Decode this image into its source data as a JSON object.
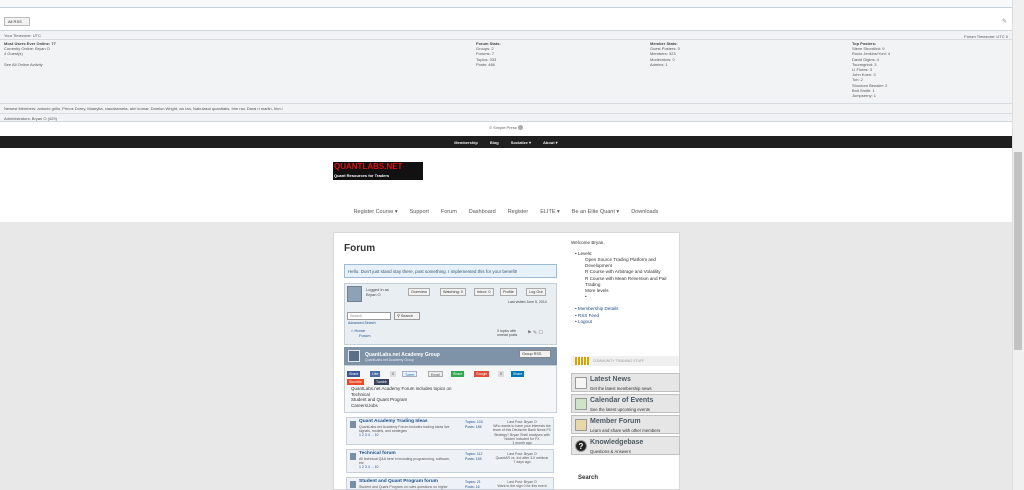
{
  "rss_label": "All RSS",
  "stats": {
    "your_timezone": "Your Timezone: UTC",
    "forum_timezone": "Forum Timezone: UTC 0",
    "most_users": "Most Users Ever Online: 77",
    "currently_online": "Currently Online: Bryan O",
    "guests": "4 Guest(s)",
    "see_all": "See All Online Activity",
    "forum_stats": [
      "Forum Stats:",
      "Groups: 2",
      "Forums: 7",
      "Topics: 333",
      "Posts: 466"
    ],
    "member_stats": [
      "Member Stats:",
      "Guest Posters: 0",
      "Members: 323",
      "Moderators: 0",
      "Admins: 1"
    ],
    "top_posters": [
      "Top Posters:",
      "Steve Sbordlich: 9",
      "Rocio Jenkins/Yoni: 4",
      "David Digins: 4",
      "Tourmgrind: 3",
      "LI Flores: 3",
      "John Koen: 3",
      "Toh: 2",
      "Shoutom Benaler: 2",
      "Bnit Smith: 1",
      "Jumpserny: 1"
    ],
    "newest_members": "Newest Members: antonio grillo, Prinos Dorey, Maaryita, claudasmeta, ahri kumar, Damion Wright, ws Ian, Nabulasul quantlabs, Irim rav, Darai ri marlin, Irim i",
    "administrators": "Administrators: Bryan O (429)"
  },
  "simplepress": "© Simple:Press",
  "topnav": [
    "Membership",
    "Blog",
    "Socialize",
    "About"
  ],
  "logo": {
    "title": "QUANTLABS.NET",
    "tagline": "Quant Resources for Traders"
  },
  "mainnav": [
    "Register Course",
    "Support",
    "Forum",
    "Dashboard",
    "Register",
    "ELITE",
    "Be an Elite Quant",
    "Downloads"
  ],
  "forum": {
    "title": "Forum",
    "hello": "Hello. Don't just stand stay there, post something. I implemented this for your benefit!",
    "logged_in": "Logged in as",
    "user": "Bryan O",
    "tabs": [
      "Overview",
      "Watching: 0",
      "Inbox: 0",
      "Profile",
      "Log Out"
    ],
    "last_visited": "Last visited June 5, 2014",
    "search_placeholder": "Search",
    "search_btn": "Search",
    "advanced_search": "Advanced Search",
    "home": "Home",
    "forum_crumb": "Forum",
    "unread": "0 topics with unread posts",
    "group_title": "QuantLabs.net Academy Group",
    "group_sub": "QuantLabs.net Academy Group",
    "group_rss": "Group RSS",
    "share_buttons": [
      "Share",
      "Like",
      "Tweet",
      "Email",
      "Share",
      "Google",
      "Share",
      "Stumble",
      "Tumblr"
    ],
    "group_desc": [
      "QuantLabs.net Academy Forum includes topics on",
      "Technical",
      "Student and Quant Program",
      "Careers/Jobs"
    ],
    "forums": [
      {
        "name": "Quant Academy Trading Ideas",
        "desc": "QuantLabs.net Academy Forum includes trading ideas live signals, models, and strategies",
        "pages": "1 2 3 4 ... 10",
        "topics": "Topics: 103",
        "posts": "Posts: 186",
        "last": [
          "Last Post: Bryan O",
          "Who wants to have your interests the team of this Deutsche Bank News FX Strategy? Bryan Shell analyses with hidden included for FX",
          "1 month ago"
        ]
      },
      {
        "name": "Technical forum",
        "desc": "All technical Q&A here in including programming, software, etc",
        "pages": "1 2 3 4 ... 10",
        "topics": "Topics: 112",
        "posts": "Posts: 159",
        "last": [
          "Last Post: Bryan O",
          "QuantAR vs. Ind after 3.0 webinar",
          "7 days ago"
        ]
      },
      {
        "name": "Student and Quant Program forum",
        "desc": "Student and Quant Program on rules questions on higher",
        "pages": "",
        "topics": "Topics: 21",
        "posts": "Posts: 16",
        "last": [
          "Last Post: Bryan O",
          "Want to the sign 0 for this event",
          ""
        ]
      }
    ]
  },
  "sidebar": {
    "welcome": "Welcome Bryan,",
    "levels": "Levels:",
    "items": [
      "Open Source Trading Platform and Development",
      "R Course with Arbitrage and Volatility",
      "R Course with Mean Reversion and Pair Trading",
      "More levels"
    ],
    "links": [
      "Membership Details",
      "RSS Feed",
      "Logout"
    ],
    "community": "COMMUNITY TRAINING STUFF",
    "boxes": [
      {
        "title": "Latest News",
        "desc": "Get the latest membership news"
      },
      {
        "title": "Calendar of Events",
        "desc": "See the latest upcoming events"
      },
      {
        "title": "Member Forum",
        "desc": "Learn and share with other members"
      },
      {
        "title": "Knowledgebase",
        "desc": "Questions & Answers"
      }
    ],
    "search_label": "Search"
  },
  "colors": {
    "navbar": "#1f1f1f",
    "logo_red": "#dd1111",
    "link_blue": "#1d4e89",
    "group_head": "#7e93a8"
  }
}
